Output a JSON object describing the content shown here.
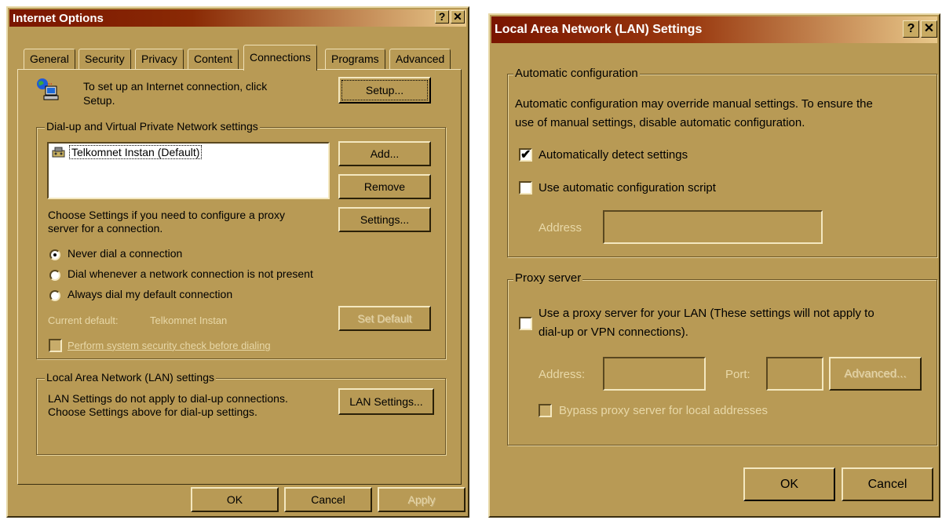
{
  "internet_options": {
    "title": "Internet Options",
    "help_glyph": "?",
    "close_glyph": "✕",
    "tabs": [
      {
        "label": "General"
      },
      {
        "label": "Security"
      },
      {
        "label": "Privacy"
      },
      {
        "label": "Content"
      },
      {
        "label": "Connections",
        "active": true
      },
      {
        "label": "Programs"
      },
      {
        "label": "Advanced"
      }
    ],
    "setup_text_line1": "To set up an Internet connection, click",
    "setup_text_line2": "Setup.",
    "setup_button": "Setup...",
    "dialup_group": "Dial-up and Virtual Private Network settings",
    "connections": [
      "Telkomnet Instan (Default)"
    ],
    "add_button": "Add...",
    "remove_button": "Remove",
    "settings_text_line1": "Choose Settings if you need to configure a proxy",
    "settings_text_line2": "server for a connection.",
    "settings_button": "Settings...",
    "radio_never": "Never dial a connection",
    "radio_whenever": "Dial whenever a network connection is not present",
    "radio_always": "Always dial my default connection",
    "current_default_label": "Current default:",
    "current_default_value": "Telkomnet Instan",
    "set_default_button": "Set Default",
    "security_check": "Perform system security check before dialing",
    "lan_group": "Local Area Network (LAN) settings",
    "lan_text_line1": "LAN Settings do not apply to dial-up connections.",
    "lan_text_line2": "Choose Settings above for dial-up settings.",
    "lan_button": "LAN Settings...",
    "ok_button": "OK",
    "cancel_button": "Cancel",
    "apply_button": "Apply"
  },
  "lan_settings": {
    "title": "Local Area Network (LAN) Settings",
    "help_glyph": "?",
    "close_glyph": "✕",
    "auto_group": "Automatic configuration",
    "auto_desc_line1": "Automatic configuration may override manual settings.  To ensure the",
    "auto_desc_line2": "use of manual settings, disable automatic configuration.",
    "auto_detect": "Automatically detect settings",
    "auto_detect_checked": true,
    "auto_script": "Use automatic configuration script",
    "address_label": "Address",
    "proxy_group": "Proxy server",
    "proxy_line1": "Use a proxy server for your LAN (These settings will not apply to",
    "proxy_line2": "dial-up or VPN connections).",
    "proxy_address_label": "Address:",
    "proxy_port_label": "Port:",
    "advanced_button": "Advanced...",
    "bypass": "Bypass proxy server for local addresses",
    "ok_button": "OK",
    "cancel_button": "Cancel"
  },
  "colors": {
    "title_gradient_start": "#7a1500",
    "title_gradient_end": "#e8c88a",
    "dialog_face": "#b89a55"
  }
}
